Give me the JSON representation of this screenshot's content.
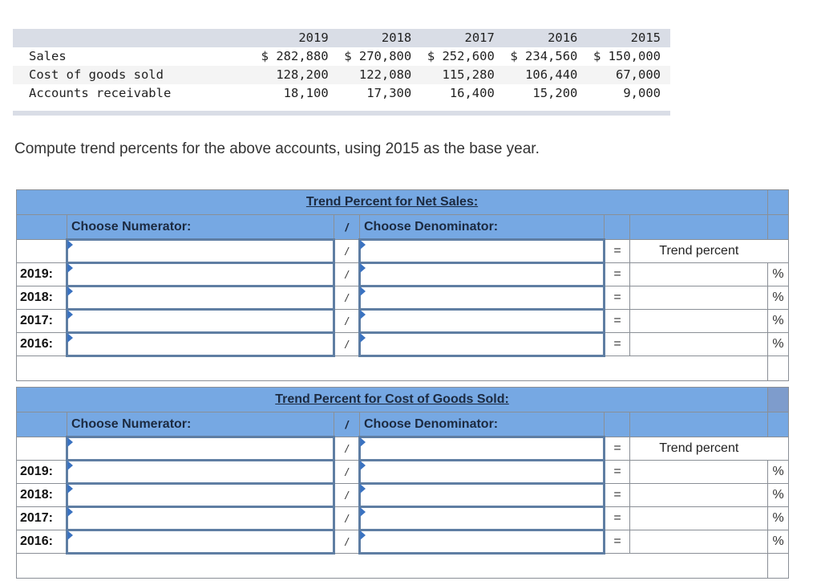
{
  "data_table": {
    "years": [
      "2019",
      "2018",
      "2017",
      "2016",
      "2015"
    ],
    "rows": [
      {
        "label": "Sales",
        "values": [
          "$ 282,880",
          "$ 270,800",
          "$ 252,600",
          "$ 234,560",
          "$ 150,000"
        ]
      },
      {
        "label": "Cost of goods sold",
        "values": [
          "128,200",
          "122,080",
          "115,280",
          "106,440",
          "67,000"
        ]
      },
      {
        "label": "Accounts receivable",
        "values": [
          "18,100",
          "17,300",
          "16,400",
          "15,200",
          "9,000"
        ]
      }
    ]
  },
  "instruction": "Compute trend percents for the above accounts, using 2015 as the base year.",
  "sections": [
    {
      "title": "Trend Percent for Net Sales:",
      "numerator_header": "Choose Numerator:",
      "slash": "/",
      "denominator_header": "Choose Denominator:",
      "equals": "=",
      "result_header": "Trend percent",
      "percent": "%",
      "rows": [
        {
          "year": "",
          "numerator": "",
          "denominator": "",
          "result": ""
        },
        {
          "year": "2019:",
          "numerator": "",
          "denominator": "",
          "result": ""
        },
        {
          "year": "2018:",
          "numerator": "",
          "denominator": "",
          "result": ""
        },
        {
          "year": "2017:",
          "numerator": "",
          "denominator": "",
          "result": ""
        },
        {
          "year": "2016:",
          "numerator": "",
          "denominator": "",
          "result": ""
        }
      ]
    },
    {
      "title": "Trend Percent for Cost of Goods Sold:",
      "numerator_header": "Choose Numerator:",
      "slash": "/",
      "denominator_header": "Choose Denominator:",
      "equals": "=",
      "result_header": "Trend percent",
      "percent": "%",
      "rows": [
        {
          "year": "",
          "numerator": "",
          "denominator": "",
          "result": ""
        },
        {
          "year": "2019:",
          "numerator": "",
          "denominator": "",
          "result": ""
        },
        {
          "year": "2018:",
          "numerator": "",
          "denominator": "",
          "result": ""
        },
        {
          "year": "2017:",
          "numerator": "",
          "denominator": "",
          "result": ""
        },
        {
          "year": "2016:",
          "numerator": "",
          "denominator": "",
          "result": ""
        }
      ]
    }
  ],
  "colors": {
    "header_blue": "#76a8e3",
    "input_border": "#5f7ea3",
    "dropdown_flag": "#3a72c0",
    "table_header_gray": "#d9dde6"
  }
}
